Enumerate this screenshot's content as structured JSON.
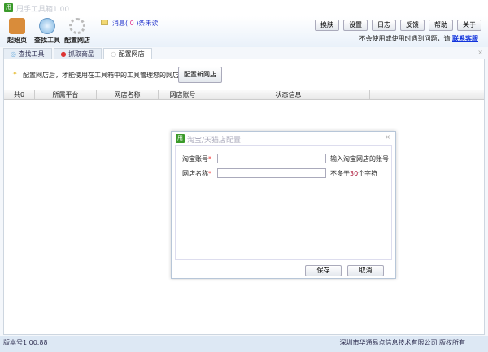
{
  "app": {
    "title": "甩手工具箱1.00",
    "logo": "甩"
  },
  "toolbar": {
    "items": [
      {
        "label": "起始页",
        "icon": "home-icon"
      },
      {
        "label": "查找工具",
        "icon": "search-icon"
      },
      {
        "label": "配置网店",
        "icon": "gear-icon"
      }
    ],
    "message": {
      "prefix": "消息(",
      "count": "0",
      "suffix": ")条未读"
    },
    "buttons": [
      "换肤",
      "设置",
      "日志",
      "反馈",
      "帮助",
      "关于"
    ],
    "help_text": "不会使用或使用时遇到问题，请",
    "help_link": "联系客服"
  },
  "tabs": [
    {
      "label": "查找工具"
    },
    {
      "label": "抓取商品"
    },
    {
      "label": "配置网店"
    }
  ],
  "main": {
    "tip": "配置网店后，才能使用在工具箱中的工具管理您的网店",
    "new_button": "配置新网店",
    "columns": [
      "共0",
      "所属平台",
      "网店名称",
      "网店账号",
      "状态信息"
    ]
  },
  "dialog": {
    "title": "淘宝/天猫店配置",
    "fields": [
      {
        "label": "淘宝账号",
        "required": "*",
        "value": "",
        "hint": "输入淘宝网店的账号"
      },
      {
        "label": "网店名称",
        "required": "*",
        "value": "",
        "hint_pre": "不多于",
        "hint_num": "30",
        "hint_post": "个字符"
      }
    ],
    "save": "保存",
    "cancel": "取消"
  },
  "status": {
    "version": "版本号1.00.88",
    "company": "深圳市华通易点信息技术有限公司 版权所有"
  }
}
